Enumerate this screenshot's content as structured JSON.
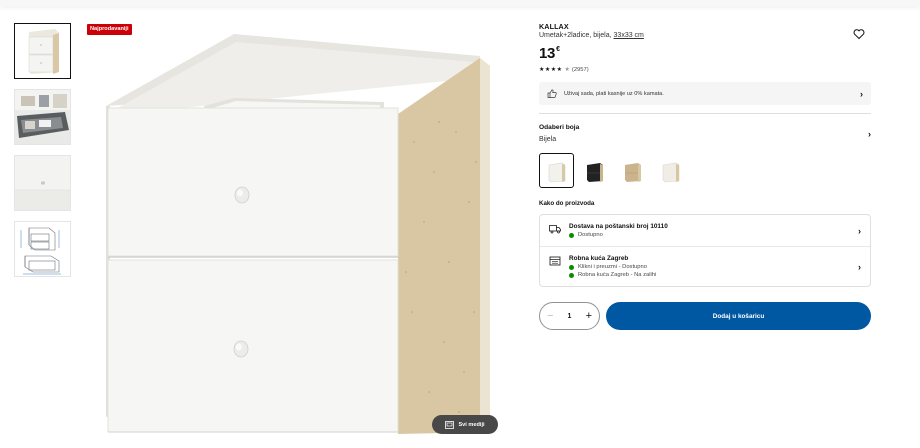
{
  "badge": "Najprodavaniji",
  "media_button": {
    "label": "Svi mediji",
    "icon": "gallery-icon"
  },
  "thumbnails": [
    {
      "name": "thumb-front",
      "active": true
    },
    {
      "name": "thumb-interior",
      "active": false
    },
    {
      "name": "thumb-closeup",
      "active": false
    },
    {
      "name": "thumb-drawing",
      "active": false
    }
  ],
  "product": {
    "brand": "KALLAX",
    "description": "Umetak+2ladice, bijela,",
    "measure": "33x33 cm",
    "price_whole": "13",
    "price_currency": "€",
    "stars": "★★★★",
    "half_star": "★",
    "review_count": "(2957)"
  },
  "payment": {
    "text": "Uživaj sada, plati kasnije uz 0% kamata."
  },
  "color": {
    "title": "Odaberi boja",
    "selected": "Bijela",
    "swatches": [
      {
        "name": "swatch-white",
        "color": "#f2f1ec",
        "active": true
      },
      {
        "name": "swatch-black",
        "color": "#222222",
        "active": false
      },
      {
        "name": "swatch-oak",
        "color": "#cbb38d",
        "active": false
      },
      {
        "name": "swatch-white-oak",
        "color": "#f0ede6",
        "active": false
      }
    ]
  },
  "how_to_get": "Kako do proizvoda",
  "delivery": {
    "title": "Dostava na poštanski broj 10110",
    "status": "Dostupno"
  },
  "store": {
    "title": "Robna kuća Zagreb",
    "line1": "Klikni i preuzmi - Dostupno",
    "line2": "Robna kuća Zagreb - Na zalihi"
  },
  "quantity": "1",
  "add_to_cart": "Dodaj u košaricu",
  "colors": {
    "accent": "#0058a3",
    "badge": "#cc0008",
    "available": "#0a8a00"
  }
}
